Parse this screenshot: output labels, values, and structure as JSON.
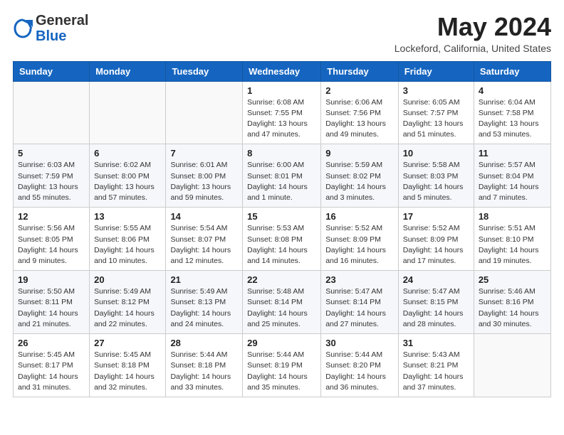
{
  "header": {
    "logo_general": "General",
    "logo_blue": "Blue",
    "month_title": "May 2024",
    "location": "Lockeford, California, United States"
  },
  "weekdays": [
    "Sunday",
    "Monday",
    "Tuesday",
    "Wednesday",
    "Thursday",
    "Friday",
    "Saturday"
  ],
  "weeks": [
    [
      {
        "day": "",
        "sunrise": "",
        "sunset": "",
        "daylight": ""
      },
      {
        "day": "",
        "sunrise": "",
        "sunset": "",
        "daylight": ""
      },
      {
        "day": "",
        "sunrise": "",
        "sunset": "",
        "daylight": ""
      },
      {
        "day": "1",
        "sunrise": "6:08 AM",
        "sunset": "7:55 PM",
        "daylight": "13 hours and 47 minutes."
      },
      {
        "day": "2",
        "sunrise": "6:06 AM",
        "sunset": "7:56 PM",
        "daylight": "13 hours and 49 minutes."
      },
      {
        "day": "3",
        "sunrise": "6:05 AM",
        "sunset": "7:57 PM",
        "daylight": "13 hours and 51 minutes."
      },
      {
        "day": "4",
        "sunrise": "6:04 AM",
        "sunset": "7:58 PM",
        "daylight": "13 hours and 53 minutes."
      }
    ],
    [
      {
        "day": "5",
        "sunrise": "6:03 AM",
        "sunset": "7:59 PM",
        "daylight": "13 hours and 55 minutes."
      },
      {
        "day": "6",
        "sunrise": "6:02 AM",
        "sunset": "8:00 PM",
        "daylight": "13 hours and 57 minutes."
      },
      {
        "day": "7",
        "sunrise": "6:01 AM",
        "sunset": "8:00 PM",
        "daylight": "13 hours and 59 minutes."
      },
      {
        "day": "8",
        "sunrise": "6:00 AM",
        "sunset": "8:01 PM",
        "daylight": "14 hours and 1 minute."
      },
      {
        "day": "9",
        "sunrise": "5:59 AM",
        "sunset": "8:02 PM",
        "daylight": "14 hours and 3 minutes."
      },
      {
        "day": "10",
        "sunrise": "5:58 AM",
        "sunset": "8:03 PM",
        "daylight": "14 hours and 5 minutes."
      },
      {
        "day": "11",
        "sunrise": "5:57 AM",
        "sunset": "8:04 PM",
        "daylight": "14 hours and 7 minutes."
      }
    ],
    [
      {
        "day": "12",
        "sunrise": "5:56 AM",
        "sunset": "8:05 PM",
        "daylight": "14 hours and 9 minutes."
      },
      {
        "day": "13",
        "sunrise": "5:55 AM",
        "sunset": "8:06 PM",
        "daylight": "14 hours and 10 minutes."
      },
      {
        "day": "14",
        "sunrise": "5:54 AM",
        "sunset": "8:07 PM",
        "daylight": "14 hours and 12 minutes."
      },
      {
        "day": "15",
        "sunrise": "5:53 AM",
        "sunset": "8:08 PM",
        "daylight": "14 hours and 14 minutes."
      },
      {
        "day": "16",
        "sunrise": "5:52 AM",
        "sunset": "8:09 PM",
        "daylight": "14 hours and 16 minutes."
      },
      {
        "day": "17",
        "sunrise": "5:52 AM",
        "sunset": "8:09 PM",
        "daylight": "14 hours and 17 minutes."
      },
      {
        "day": "18",
        "sunrise": "5:51 AM",
        "sunset": "8:10 PM",
        "daylight": "14 hours and 19 minutes."
      }
    ],
    [
      {
        "day": "19",
        "sunrise": "5:50 AM",
        "sunset": "8:11 PM",
        "daylight": "14 hours and 21 minutes."
      },
      {
        "day": "20",
        "sunrise": "5:49 AM",
        "sunset": "8:12 PM",
        "daylight": "14 hours and 22 minutes."
      },
      {
        "day": "21",
        "sunrise": "5:49 AM",
        "sunset": "8:13 PM",
        "daylight": "14 hours and 24 minutes."
      },
      {
        "day": "22",
        "sunrise": "5:48 AM",
        "sunset": "8:14 PM",
        "daylight": "14 hours and 25 minutes."
      },
      {
        "day": "23",
        "sunrise": "5:47 AM",
        "sunset": "8:14 PM",
        "daylight": "14 hours and 27 minutes."
      },
      {
        "day": "24",
        "sunrise": "5:47 AM",
        "sunset": "8:15 PM",
        "daylight": "14 hours and 28 minutes."
      },
      {
        "day": "25",
        "sunrise": "5:46 AM",
        "sunset": "8:16 PM",
        "daylight": "14 hours and 30 minutes."
      }
    ],
    [
      {
        "day": "26",
        "sunrise": "5:45 AM",
        "sunset": "8:17 PM",
        "daylight": "14 hours and 31 minutes."
      },
      {
        "day": "27",
        "sunrise": "5:45 AM",
        "sunset": "8:18 PM",
        "daylight": "14 hours and 32 minutes."
      },
      {
        "day": "28",
        "sunrise": "5:44 AM",
        "sunset": "8:18 PM",
        "daylight": "14 hours and 33 minutes."
      },
      {
        "day": "29",
        "sunrise": "5:44 AM",
        "sunset": "8:19 PM",
        "daylight": "14 hours and 35 minutes."
      },
      {
        "day": "30",
        "sunrise": "5:44 AM",
        "sunset": "8:20 PM",
        "daylight": "14 hours and 36 minutes."
      },
      {
        "day": "31",
        "sunrise": "5:43 AM",
        "sunset": "8:21 PM",
        "daylight": "14 hours and 37 minutes."
      },
      {
        "day": "",
        "sunrise": "",
        "sunset": "",
        "daylight": ""
      }
    ]
  ]
}
